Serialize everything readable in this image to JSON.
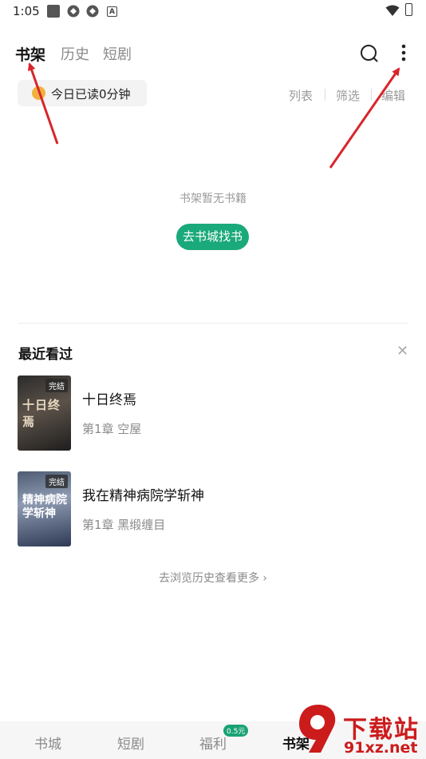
{
  "status_bar": {
    "time": "1:05"
  },
  "top_tabs": [
    {
      "label": "书架"
    },
    {
      "label": "历史"
    },
    {
      "label": "短剧"
    }
  ],
  "reading": {
    "today_text": "今日已读0分钟"
  },
  "toolbar": {
    "list": "列表",
    "filter": "筛选",
    "edit": "编辑"
  },
  "empty_state": {
    "message": "书架暂无书籍",
    "button": "去书城找书"
  },
  "recent": {
    "title": "最近看过",
    "books": [
      {
        "badge": "完结",
        "cover_text": "十日终焉",
        "title": "十日终焉",
        "chapter": "第1章 空屋"
      },
      {
        "badge": "完结",
        "cover_text": "精神病院学斩神",
        "title": "我在精神病院学斩神",
        "chapter": "第1章 黑缎缠目"
      }
    ],
    "more_link": "去浏览历史查看更多 ›"
  },
  "bottom_nav": {
    "items": [
      {
        "label": "书城"
      },
      {
        "label": "短剧"
      },
      {
        "label": "福利"
      },
      {
        "label": "书架"
      }
    ],
    "welfare_badge": "0.5元"
  },
  "watermark": {
    "line1": "下载站",
    "line2": "91xz.net",
    "logo": "9"
  },
  "colors": {
    "accent": "#1aa97a",
    "arrow": "#d9252b",
    "watermark": "#cc1b1b"
  }
}
